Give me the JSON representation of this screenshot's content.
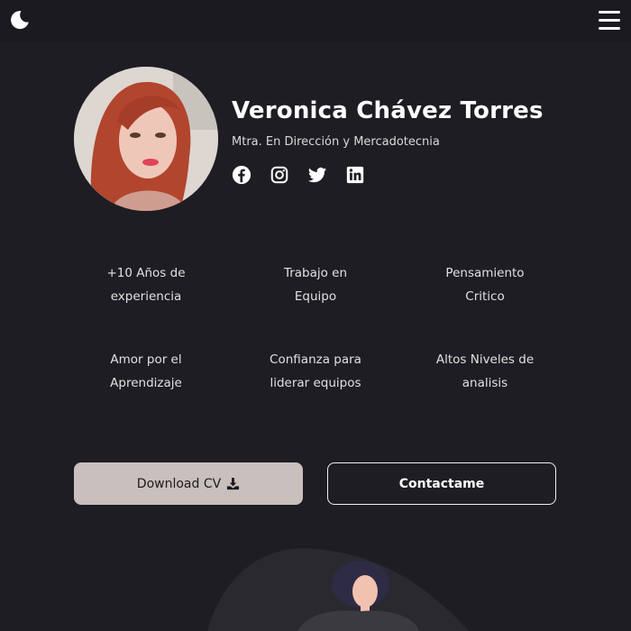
{
  "topbar": {
    "theme_toggle_icon": "moon-icon",
    "menu_icon": "hamburger-menu-icon"
  },
  "profile": {
    "name": "Veronica Chávez Torres",
    "title": "Mtra. En Dirección y Mercadotecnia",
    "socials": [
      "facebook-icon",
      "instagram-icon",
      "twitter-icon",
      "linkedin-icon"
    ]
  },
  "qualities": [
    {
      "text": "+10 Años de\nexperiencia"
    },
    {
      "text": "Trabajo en\nEquipo"
    },
    {
      "text": "Pensamiento\nCritico"
    },
    {
      "text": "Amor por el\nAprendizaje"
    },
    {
      "text": "Confianza para\nliderar equipos"
    },
    {
      "text": "Altos Niveles de\nanalisis"
    }
  ],
  "actions": {
    "download_label": "Download CV",
    "download_icon": "download-icon",
    "contact_label": "Contactame"
  },
  "colors": {
    "background": "#1e1d23",
    "primary_button": "#c9bfbc",
    "text": "#ffffff"
  }
}
